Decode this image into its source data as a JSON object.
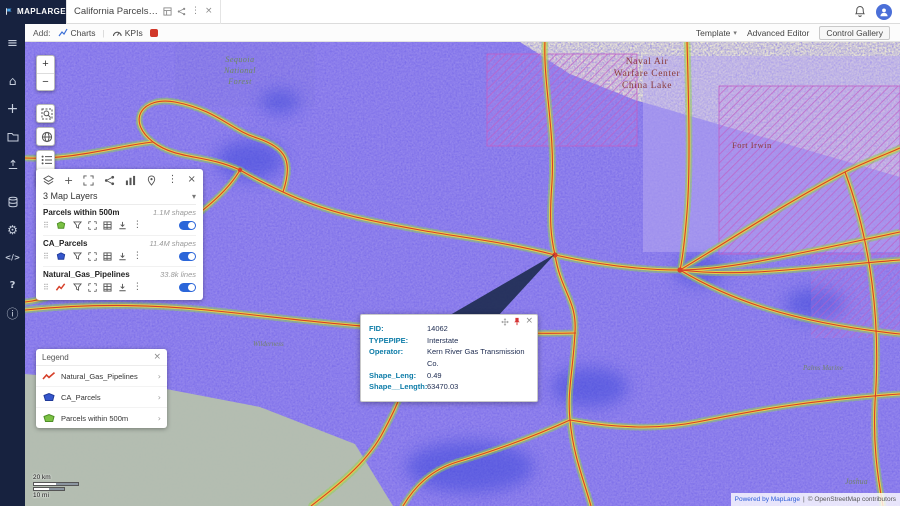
{
  "glyphs": {
    "hamburger": "≡",
    "home": "⌂",
    "plus": "+",
    "gear": "⚙",
    "code": "</>",
    "help": "?",
    "info": "ⓘ",
    "kebab": "⋮",
    "close": "×",
    "chevron_down": "▾",
    "chevron_right": "›",
    "drag_handle": "⠿",
    "divider": "|"
  },
  "header": {
    "logo": "MAPLARGE",
    "tab_title": "California Parcels ..."
  },
  "toolbar": {
    "add_label": "Add:",
    "charts_label": "Charts",
    "kpis_label": "KPIs",
    "template_label": "Template",
    "advanced_editor_label": "Advanced Editor",
    "control_gallery_label": "Control Gallery"
  },
  "map_controls": {
    "zoom_in": "+",
    "zoom_out": "−"
  },
  "layers_panel": {
    "title": "3 Map Layers",
    "layers": [
      {
        "name": "Parcels within 500m",
        "count": "1.1M shapes",
        "color": "#7bc144"
      },
      {
        "name": "CA_Parcels",
        "count": "11.4M shapes",
        "color": "#3556cc"
      },
      {
        "name": "Natural_Gas_Pipelines",
        "count": "33.8k lines",
        "color": "#d6402a"
      }
    ]
  },
  "legend": {
    "title": "Legend",
    "items": [
      {
        "name": "Natural_Gas_Pipelines"
      },
      {
        "name": "CA_Parcels"
      },
      {
        "name": "Parcels within 500m"
      }
    ]
  },
  "popup": {
    "fields": [
      {
        "label": "FID:",
        "value": "14062"
      },
      {
        "label": "TYPEPIPE:",
        "value": "Interstate"
      },
      {
        "label": "Operator:",
        "value": "Kern River Gas Transmission Co."
      },
      {
        "label": "Shape_Leng:",
        "value": "0.49"
      },
      {
        "label": "Shape__Length:",
        "value": "63470.03"
      }
    ]
  },
  "map": {
    "labels": {
      "sequoia_1": "Sequoia",
      "sequoia_2": "National",
      "sequoia_3": "Forest",
      "naval_1": "Naval Air",
      "naval_2": "Warfare Center",
      "naval_3": "China Lake",
      "fort_irwin": "Fort Irwin",
      "wilderness": "Wilderness",
      "palms": "Palms Marine",
      "joshua": "Joshua"
    },
    "scale_km": "20 km",
    "scale_mi": "10 mi",
    "attribution_brand": "Powered by MapLarge",
    "attribution_osm": "© OpenStreetMap contributors"
  },
  "colors": {
    "accent_blue": "#2b66d9",
    "pipeline_red": "#d6402a",
    "parcel_purple": "#7e6ef2",
    "parcels_green": "#7bc144",
    "ca_parcels_blue": "#3556cc",
    "military_hatch": "#c05ec6"
  }
}
